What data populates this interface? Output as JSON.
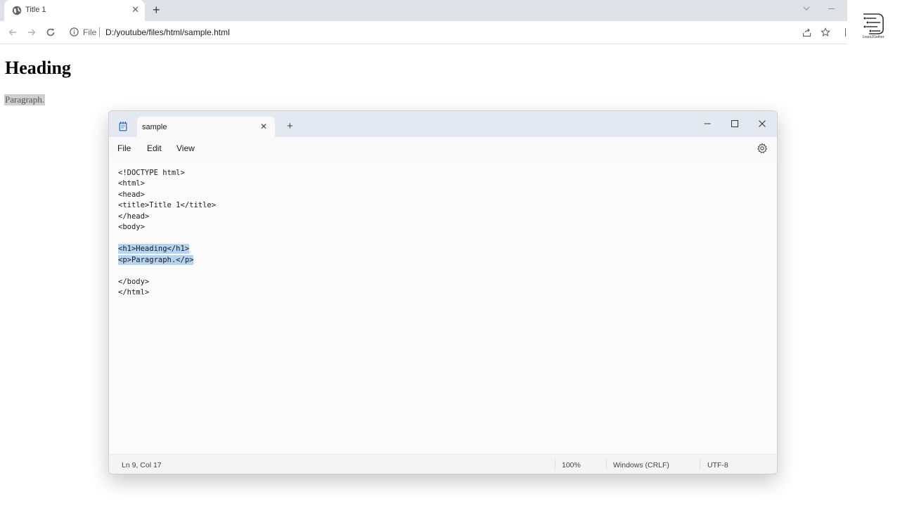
{
  "browser": {
    "tab_title": "Title 1",
    "url_scheme": "File",
    "url": "D:/youtube/files/html/sample.html"
  },
  "logo": {
    "text": "Learn2Gether"
  },
  "page": {
    "heading": "Heading",
    "paragraph": "Paragraph."
  },
  "notepad": {
    "tab_title": "sample",
    "menu": [
      "File",
      "Edit",
      "View"
    ],
    "code_lines": [
      "<!DOCTYPE html>",
      "<html>",
      "<head>",
      "<title>Title 1</title>",
      "</head>",
      "<body>",
      "",
      "<h1>Heading</h1>",
      "<p>Paragraph.</p>",
      "",
      "</body>",
      "</html>"
    ],
    "status": {
      "position": "Ln 9, Col 17",
      "zoom": "100%",
      "line_ending": "Windows (CRLF)",
      "encoding": "UTF-8"
    }
  },
  "colors": {
    "selection": "#b5d4f2",
    "titlebar": "#e4e9f1",
    "tabstrip": "#dee1e6"
  }
}
